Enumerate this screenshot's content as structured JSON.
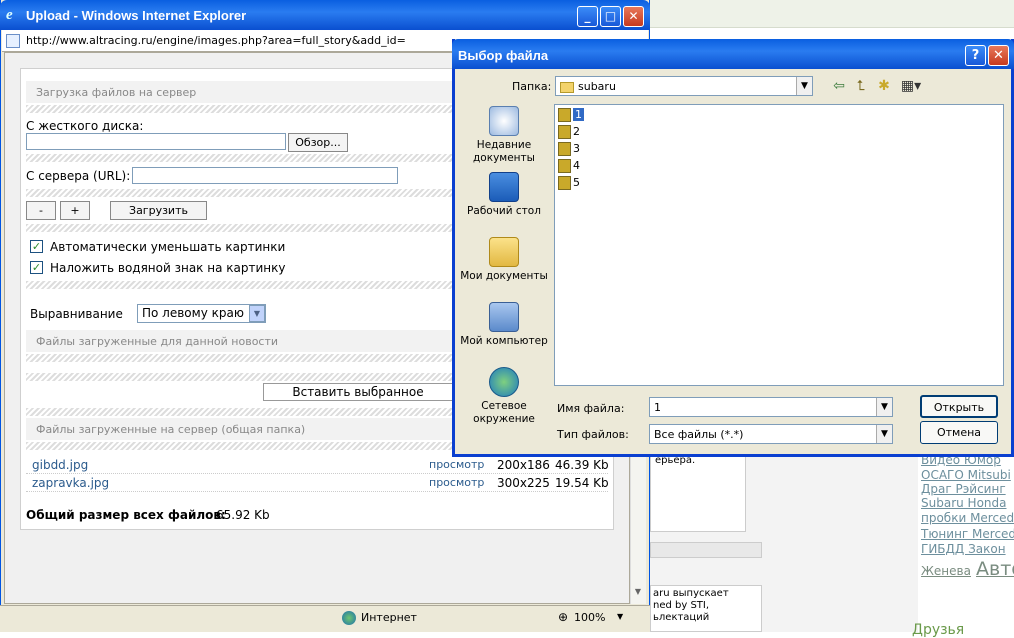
{
  "ie": {
    "title": "Upload - Windows Internet Explorer",
    "address": "http://www.altracing.ru/engine/images.php?area=full_story&add_id=",
    "status_zone": "Интернет",
    "zoom": "100%"
  },
  "upload": {
    "section1_header": "Загрузка файлов на сервер",
    "hard_disk_label": "С жесткого диска:",
    "browse_button": "Обзор...",
    "server_url_label": "С сервера (URL):",
    "minus_button": "-",
    "plus_button": "+",
    "upload_button": "Загрузить",
    "auto_resize_label": "Автоматически уменьшать картинки",
    "watermark_label": "Наложить водяной знак на картинку",
    "alignment_label": "Выравнивание",
    "alignment_value": "По левому краю",
    "section2_header": "Файлы загруженные для данной новости",
    "insert_selected_button": "Вставить выбранное",
    "section3_header": "Файлы загруженные на сервер (общая папка)",
    "files": [
      {
        "name": "gibdd.jpg",
        "action": "просмотр",
        "dims": "200x186",
        "size": "46.39 Kb"
      },
      {
        "name": "zapravka.jpg",
        "action": "просмотр",
        "dims": "300x225",
        "size": "19.54 Kb"
      }
    ],
    "total_label": "Общий размер всех файлов:",
    "total_value": "65.92 Kb"
  },
  "dialog": {
    "title": "Выбор файла",
    "folder_label": "Папка:",
    "folder_value": "subaru",
    "places": [
      "Недавние документы",
      "Рабочий стол",
      "Мои документы",
      "Мой компьютер",
      "Сетевое окружение"
    ],
    "files": [
      "1",
      "2",
      "3",
      "4",
      "5"
    ],
    "filename_label": "Имя файла:",
    "filename_value": "1",
    "filetype_label": "Тип файлов:",
    "filetype_value": "Все файлы (*.*)",
    "open_button": "Открыть",
    "cancel_button": "Отмена"
  },
  "background": {
    "box1_text": "ерьера.",
    "box2_lines": [
      "aru выпускает",
      "ned by STI,",
      "ьлектаций"
    ],
    "tag_lines": [
      "Видео Юмор",
      "ОСАГО Mitsubi",
      "Драг Рэйсинг",
      "Subaru Honda",
      "пробки Mercede",
      "Тюнинг Mercede",
      "ГИБДД Закон"
    ],
    "tag_last_small": "Женева",
    "tag_last_big": "Авто",
    "footer_text": "Друзья"
  }
}
